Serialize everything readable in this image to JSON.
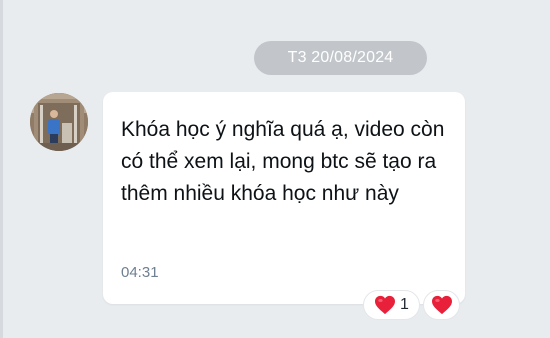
{
  "chat": {
    "date_separator": "T3 20/08/2024",
    "message": {
      "text": "Khóa học ý nghĩa quá ạ, video còn có thể xem lại, mong btc sẽ tạo ra thêm nhiều khóa học như này",
      "time": "04:31"
    },
    "reactions": [
      {
        "icon": "heart-icon",
        "count": "1"
      },
      {
        "icon": "heart-icon",
        "count": ""
      }
    ]
  },
  "colors": {
    "background": "#e9ecef",
    "date_pill": "#c2c6cb",
    "bubble": "#ffffff",
    "time_text": "#6e7f91",
    "heart": "#e8203a"
  }
}
